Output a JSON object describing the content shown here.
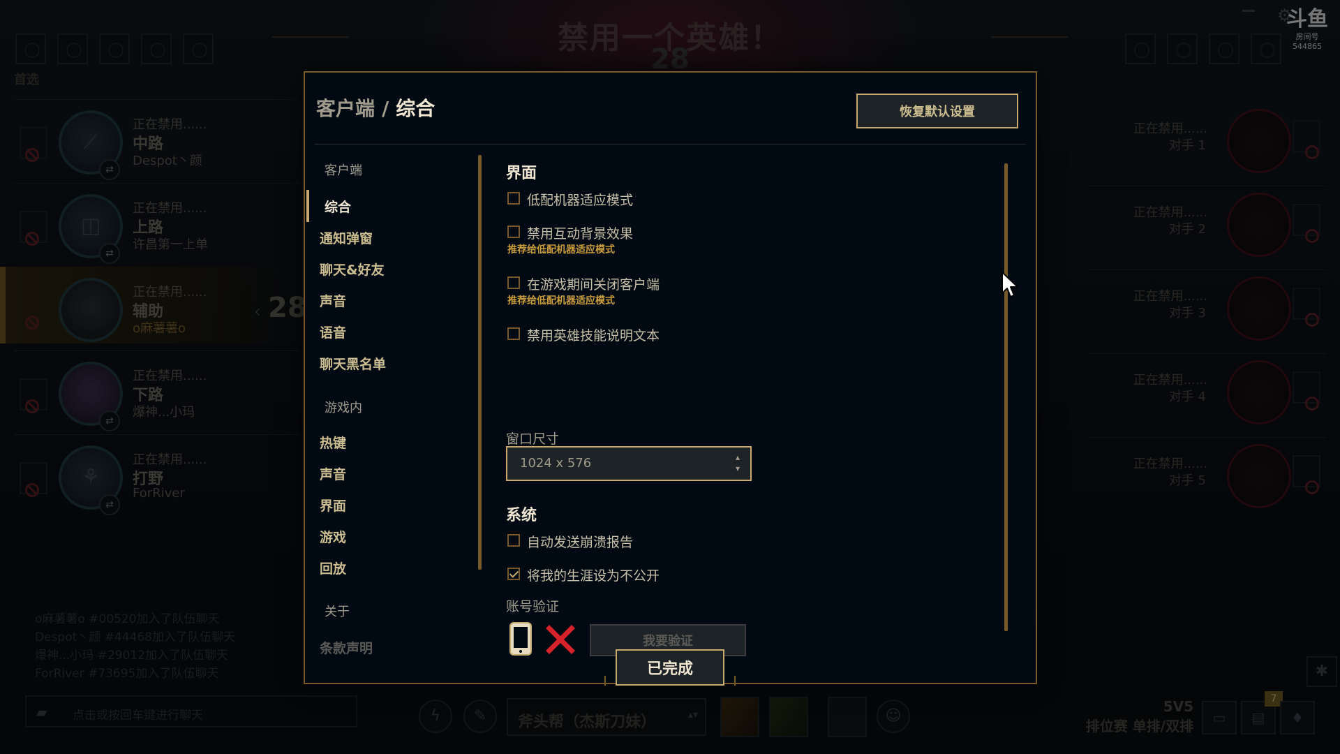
{
  "header": {
    "ban_title": "禁用一个英雄！",
    "timer": "28",
    "first_pick_label": "首选",
    "watermark_logo": "斗鱼",
    "watermark_room_label": "房间号",
    "watermark_room_id": "544865"
  },
  "team": {
    "players": [
      {
        "status": "正在禁用......",
        "role": "中路",
        "name": "Despot丶颜"
      },
      {
        "status": "正在禁用......",
        "role": "上路",
        "name": "许昌第一上单"
      },
      {
        "status": "正在禁用......",
        "role": "辅助",
        "name": "o麻薯薯o"
      },
      {
        "status": "正在禁用......",
        "role": "下路",
        "name": "爆神...小玛"
      },
      {
        "status": "正在禁用......",
        "role": "打野",
        "name": "ForRiver"
      }
    ],
    "side_timer": "28"
  },
  "enemies": [
    {
      "status": "正在禁用......",
      "label": "对手 1"
    },
    {
      "status": "正在禁用......",
      "label": "对手 2"
    },
    {
      "status": "正在禁用......",
      "label": "对手 3"
    },
    {
      "status": "正在禁用......",
      "label": "对手 4"
    },
    {
      "status": "正在禁用......",
      "label": "对手 5"
    }
  ],
  "chat": {
    "log": [
      "o麻薯薯o #00520加入了队伍聊天",
      "Despot丶颜 #44468加入了队伍聊天",
      "爆神...小玛 #29012加入了队伍聊天",
      "ForRiver #73695加入了队伍聊天"
    ],
    "input_placeholder": "点击或按回车键进行聊天"
  },
  "bottom_bar": {
    "skin_select": "斧头帮（杰斯刀妹）",
    "mode_size": "5V5",
    "mode_name": "排位赛 单排/双排",
    "notification_count": "7"
  },
  "modal": {
    "breadcrumb_parent": "客户端",
    "breadcrumb_separator": "/",
    "breadcrumb_current": "综合",
    "reset_button": "恢复默认设置",
    "done_button": "已完成",
    "nav": {
      "section_client": "客户端",
      "client_items": [
        "综合",
        "通知弹窗",
        "聊天&好友",
        "声音",
        "语音",
        "聊天黑名单"
      ],
      "section_ingame": "游戏内",
      "ingame_items": [
        "热键",
        "声音",
        "界面",
        "游戏",
        "回放"
      ],
      "section_about": "关于",
      "about_items": [
        "条款声明"
      ]
    },
    "content": {
      "interface_title": "界面",
      "options_interface": [
        {
          "label": "低配机器适应模式",
          "checked": false
        },
        {
          "label": "禁用互动背景效果",
          "checked": false,
          "hint": "推荐给低配机器适应模式"
        },
        {
          "label": "在游戏期间关闭客户端",
          "checked": false,
          "hint": "推荐给低配机器适应模式"
        },
        {
          "label": "禁用英雄技能说明文本",
          "checked": false
        }
      ],
      "window_size_label": "窗口尺寸",
      "window_size_value": "1024 x 576",
      "system_title": "系统",
      "options_system": [
        {
          "label": "自动发送崩溃报告",
          "checked": false
        },
        {
          "label": "将我的生涯设为不公开",
          "checked": true
        }
      ],
      "account_verify_label": "账号验证",
      "verify_button": "我要验证"
    }
  },
  "colors": {
    "gold": "#c8aa6e",
    "gold_dark": "#785a28",
    "hint_gold": "#c89b3c",
    "panel_bg": "#010a13",
    "verify_x_red": "#d8222a"
  }
}
